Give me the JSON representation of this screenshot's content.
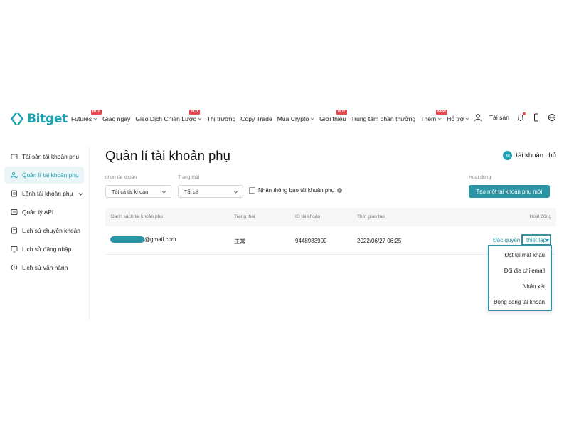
{
  "header": {
    "logo_text": "Bitget",
    "brand_color": "#1da2b4",
    "nav": [
      {
        "label": "Futures",
        "badge": "HOT",
        "chevron": true
      },
      {
        "label": "Giao ngay",
        "badge": "",
        "chevron": false
      },
      {
        "label": "Giao Dịch Chiến Lược",
        "badge": "HOT",
        "chevron": true
      },
      {
        "label": "Thị trường",
        "badge": "",
        "chevron": false
      },
      {
        "label": "Copy Trade",
        "badge": "",
        "chevron": false
      },
      {
        "label": "Mua Crypto",
        "badge": "",
        "chevron": true
      },
      {
        "label": "Giới thiệu",
        "badge": "HOT",
        "chevron": false
      },
      {
        "label": "Trung tâm phần thưởng",
        "badge": "",
        "chevron": false
      },
      {
        "label": "Thêm",
        "badge": "NEW",
        "chevron": true
      },
      {
        "label": "Hỗ trợ",
        "badge": "",
        "chevron": true
      }
    ],
    "right": {
      "user_icon": "user-icon",
      "assets_label": "Tài sản",
      "bell_icon": "bell-icon",
      "phone_icon": "phone-icon",
      "globe_icon": "globe-icon"
    }
  },
  "sidebar": {
    "items": [
      {
        "label": "Tài sản tài khoản phụ",
        "icon": "wallet-icon",
        "active": false
      },
      {
        "label": "Quản lí tài khoản phụ",
        "icon": "users-icon",
        "active": true
      },
      {
        "label": "Lệnh tài khoản phụ",
        "icon": "order-icon",
        "active": false,
        "expandable": true
      },
      {
        "label": "Quản lý API",
        "icon": "api-icon",
        "active": false
      },
      {
        "label": "Lịch sử chuyển khoản",
        "icon": "transfer-icon",
        "active": false
      },
      {
        "label": "Lịch sử đăng nhập",
        "icon": "login-icon",
        "active": false
      },
      {
        "label": "Lịch sử vận hành",
        "icon": "history-icon",
        "active": false
      }
    ]
  },
  "main": {
    "title": "Quản lí tài khoản phụ",
    "main_account": {
      "avatar_text": "ke",
      "label": "tài khoản chủ"
    },
    "filters": {
      "account_label": "chọn tài khoản",
      "account_value": "Tất cả tài khoản",
      "status_label": "Trạng thái",
      "status_value": "Tất cả",
      "notify_label": "Nhận thông báo tài khoản phụ",
      "notify_checked": false
    },
    "actions": {
      "label": "Hoạt động",
      "create_button": "Tạo một tài khoản phụ mới"
    },
    "table": {
      "headers": [
        "Danh sách tài khoản phụ",
        "Trạng thái",
        "ID tài khoản",
        "Thời gian tạo",
        "Hoạt động"
      ],
      "rows": [
        {
          "email_suffix": "@gmail.com",
          "status": "正常",
          "account_id": "9448983909",
          "created": "2022/06/27 06:25",
          "privilege": "Đặc quyền",
          "settings": "thiết lập"
        }
      ]
    },
    "settings_menu": [
      "Đặt lại mật khẩu",
      "Đổi địa chỉ email",
      "Nhận xét",
      "Đóng băng tài khoản"
    ]
  }
}
